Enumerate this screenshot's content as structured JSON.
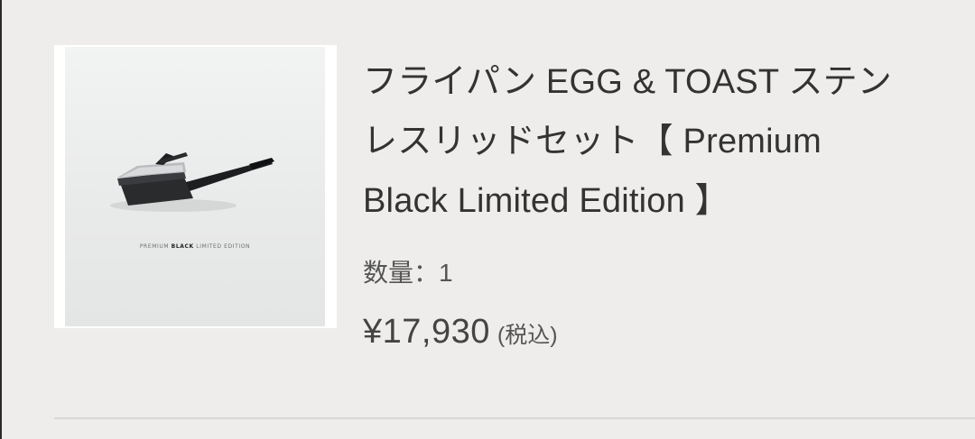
{
  "item": {
    "title_lines": [
      "フライパン EGG & TOAST ステン",
      "レスリッドセット【 Premium",
      "Black Limited Edition 】"
    ],
    "quantity_text": "数量：1",
    "price": "¥17,930",
    "tax_note": "(税込)",
    "image": {
      "edition_prefix": "PREMIUM",
      "edition_bold": "BLACK",
      "edition_suffix": "LIMITED EDITION",
      "subject": "black-frying-pan-with-stainless-lid"
    }
  },
  "colors": {
    "background": "#eeedeb",
    "text": "#333333",
    "divider": "#d9d8d6"
  }
}
